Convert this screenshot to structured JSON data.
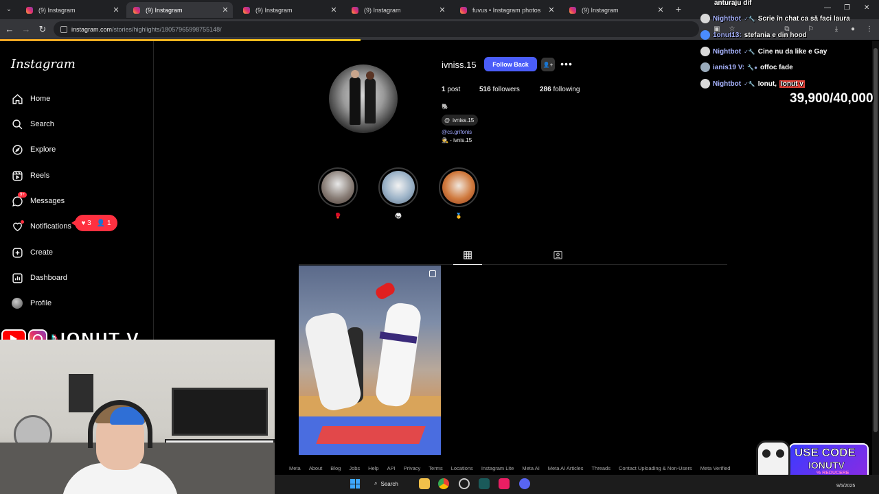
{
  "browser": {
    "tabs": [
      {
        "title": "(9) Instagram",
        "active": false
      },
      {
        "title": "(9) Instagram",
        "active": true
      },
      {
        "title": "(9) Instagram",
        "active": false
      },
      {
        "title": "(9) Instagram",
        "active": false
      },
      {
        "title": "fuvus • Instagram photos and v",
        "active": false
      },
      {
        "title": "(9) Instagram",
        "active": false
      }
    ],
    "url_host": "instagram.com",
    "url_path": "/stories/highlights/18057965998755148/",
    "new_tab": "+"
  },
  "sidebar": {
    "logo": "Instagram",
    "items": [
      {
        "label": "Home",
        "icon": "home-icon"
      },
      {
        "label": "Search",
        "icon": "search-icon"
      },
      {
        "label": "Explore",
        "icon": "compass-icon"
      },
      {
        "label": "Reels",
        "icon": "reels-icon"
      },
      {
        "label": "Messages",
        "icon": "messenger-icon",
        "badge": "9+"
      },
      {
        "label": "Notifications",
        "icon": "heart-icon"
      },
      {
        "label": "Create",
        "icon": "plus-square-icon"
      },
      {
        "label": "Dashboard",
        "icon": "dashboard-icon"
      },
      {
        "label": "Profile",
        "icon": "avatar"
      }
    ],
    "notif_pill": {
      "likes": "3",
      "follows": "1"
    }
  },
  "profile": {
    "username": "ivniss.15",
    "follow_label": "Follow Back",
    "stats": {
      "posts": {
        "value": "1",
        "label": "post"
      },
      "followers": {
        "value": "516",
        "label": "followers"
      },
      "following": {
        "value": "286",
        "label": "following"
      }
    },
    "bio_emoji": "🐘",
    "threads_handle": "ivniss.15",
    "bio_link": "@cs.grifonis",
    "bio_line": "🕵 - ivnis.15"
  },
  "highlights": [
    {
      "label": "🥊"
    },
    {
      "label": "🥋"
    },
    {
      "label": "🥇"
    }
  ],
  "overlay": {
    "brand_name": "IONUT V",
    "chat_top": "anturaju dif",
    "chat": [
      {
        "name": "Nightbot",
        "message": "Scrie în chat ca să faci laura",
        "mention": ""
      },
      {
        "name": "1onut13:",
        "message": "stefania e din hood",
        "mention": ""
      },
      {
        "name": "Nightbot",
        "message": "Cine nu da like e Gay",
        "mention": ""
      },
      {
        "name": "ianis19 V:",
        "message": "offoc fade",
        "mention": ""
      },
      {
        "name": "Nightbot",
        "message": "Ionut,",
        "mention": "Ionut v"
      }
    ],
    "counter": "39,900/40,000",
    "promo": {
      "line1": "USE CODE",
      "line2": "IONUTV",
      "line3": "% REDUCERE"
    }
  },
  "footer": [
    "Meta",
    "About",
    "Blog",
    "Jobs",
    "Help",
    "API",
    "Privacy",
    "Terms",
    "Locations",
    "Instagram Lite",
    "Meta AI",
    "Meta AI Articles",
    "Threads",
    "Contact Uploading & Non-Users",
    "Meta Verified"
  ],
  "taskbar": {
    "search_label": "Search",
    "date": "9/5/2025"
  }
}
